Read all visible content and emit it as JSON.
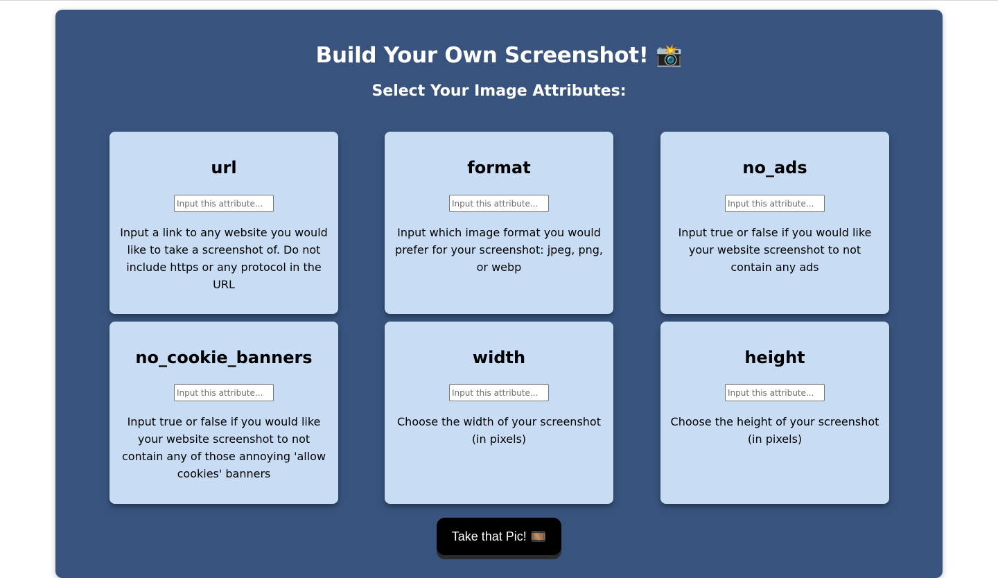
{
  "header": {
    "title": "Build Your Own Screenshot! 📸",
    "subtitle": "Select Your Image Attributes:"
  },
  "cards": [
    {
      "title": "url",
      "placeholder": "Input this attribute...",
      "description": "Input a link to any website you would like to take a screenshot of. Do not include https or any protocol in the URL"
    },
    {
      "title": "format",
      "placeholder": "Input this attribute...",
      "description": "Input which image format you would prefer for your screenshot: jpeg, png, or webp"
    },
    {
      "title": "no_ads",
      "placeholder": "Input this attribute...",
      "description": "Input true or false if you would like your website screenshot to not contain any ads"
    },
    {
      "title": "no_cookie_banners",
      "placeholder": "Input this attribute...",
      "description": "Input true or false if you would like your website screenshot to not contain any of those annoying 'allow cookies' banners"
    },
    {
      "title": "width",
      "placeholder": "Input this attribute...",
      "description": "Choose the width of your screenshot (in pixels)"
    },
    {
      "title": "height",
      "placeholder": "Input this attribute...",
      "description": "Choose the height of your screenshot (in pixels)"
    }
  ],
  "action": {
    "label": "Take that Pic!",
    "emoji": "🎞️"
  },
  "colors": {
    "panel": "#38547e",
    "card": "#c8dcf3",
    "button": "#000000"
  }
}
